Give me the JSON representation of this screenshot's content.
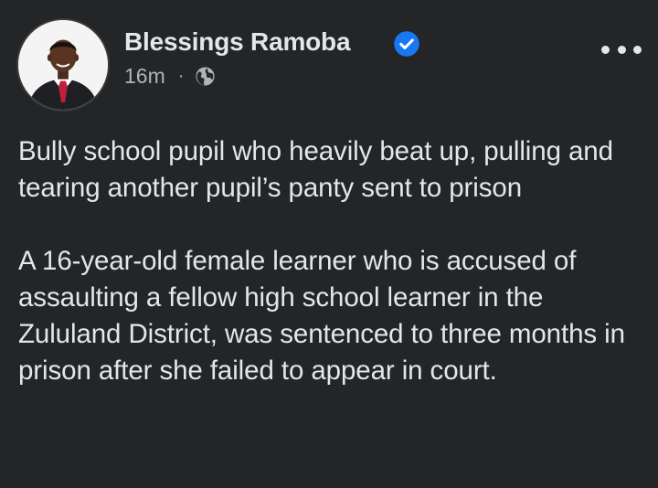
{
  "post": {
    "author": {
      "name": "Blessings Ramoba",
      "verified_icon": "verified-badge-icon",
      "avatar_icon": "profile-photo"
    },
    "meta": {
      "timestamp": "16m",
      "separator": "·",
      "audience_icon": "globe-icon"
    },
    "menu_icon": "more-options-icon",
    "body": {
      "headline": "Bully school pupil who heavily beat up, pulling and tearing another pupil’s panty sent to prison",
      "paragraph": "A 16-year-old female learner who is accused of assaulting a fellow high school learner in the Zululand District, was sentenced to three months in prison after she failed to appear in court."
    },
    "colors": {
      "background": "#242526",
      "primary_text": "#e4e6eb",
      "secondary_text": "#b0b3b8",
      "verified_blue": "#1877f2"
    }
  }
}
